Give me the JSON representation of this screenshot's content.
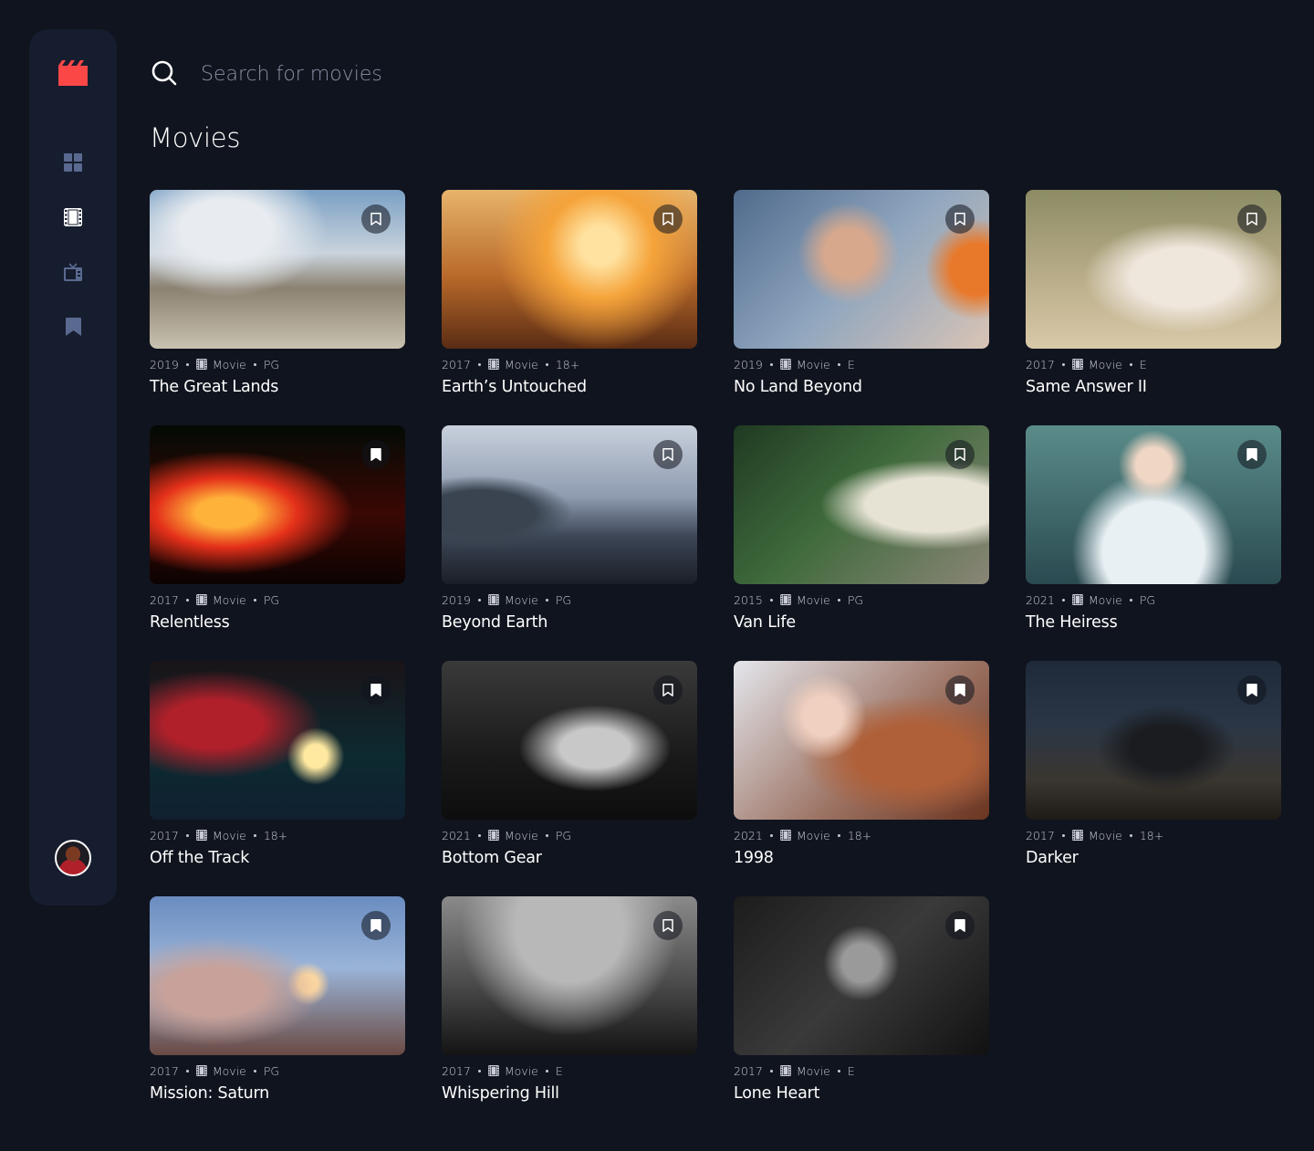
{
  "app": {
    "logo_icon": "film-clapper-icon",
    "accent_color": "#fc4747",
    "background_color": "#10141e",
    "sidebar_color": "#161d2f"
  },
  "sidebar": {
    "items": [
      {
        "name": "home",
        "icon": "grid-icon",
        "active": false
      },
      {
        "name": "movies",
        "icon": "film-icon",
        "active": true
      },
      {
        "name": "tv-series",
        "icon": "tv-icon",
        "active": false
      },
      {
        "name": "bookmarks",
        "icon": "bookmark-icon",
        "active": false
      }
    ],
    "avatar_icon": "user-avatar"
  },
  "search": {
    "placeholder": "Search for movies",
    "value": ""
  },
  "page": {
    "title": "Movies"
  },
  "movies": [
    {
      "year": "2019",
      "category": "Movie",
      "rating": "PG",
      "title": "The Great Lands",
      "bookmarked": false
    },
    {
      "year": "2017",
      "category": "Movie",
      "rating": "18+",
      "title": "Earth’s Untouched",
      "bookmarked": false
    },
    {
      "year": "2019",
      "category": "Movie",
      "rating": "E",
      "title": "No Land Beyond",
      "bookmarked": false
    },
    {
      "year": "2017",
      "category": "Movie",
      "rating": "E",
      "title": "Same Answer II",
      "bookmarked": false
    },
    {
      "year": "2017",
      "category": "Movie",
      "rating": "PG",
      "title": "Relentless",
      "bookmarked": true
    },
    {
      "year": "2019",
      "category": "Movie",
      "rating": "PG",
      "title": "Beyond Earth",
      "bookmarked": false
    },
    {
      "year": "2015",
      "category": "Movie",
      "rating": "PG",
      "title": "Van Life",
      "bookmarked": false
    },
    {
      "year": "2021",
      "category": "Movie",
      "rating": "PG",
      "title": "The Heiress",
      "bookmarked": true
    },
    {
      "year": "2017",
      "category": "Movie",
      "rating": "18+",
      "title": "Off the Track",
      "bookmarked": true
    },
    {
      "year": "2021",
      "category": "Movie",
      "rating": "PG",
      "title": "Bottom Gear",
      "bookmarked": false
    },
    {
      "year": "2021",
      "category": "Movie",
      "rating": "18+",
      "title": "1998",
      "bookmarked": true
    },
    {
      "year": "2017",
      "category": "Movie",
      "rating": "18+",
      "title": "Darker",
      "bookmarked": true
    },
    {
      "year": "2017",
      "category": "Movie",
      "rating": "PG",
      "title": "Mission: Saturn",
      "bookmarked": true
    },
    {
      "year": "2017",
      "category": "Movie",
      "rating": "E",
      "title": "Whispering Hill",
      "bookmarked": false
    },
    {
      "year": "2017",
      "category": "Movie",
      "rating": "E",
      "title": "Lone Heart",
      "bookmarked": true
    }
  ]
}
